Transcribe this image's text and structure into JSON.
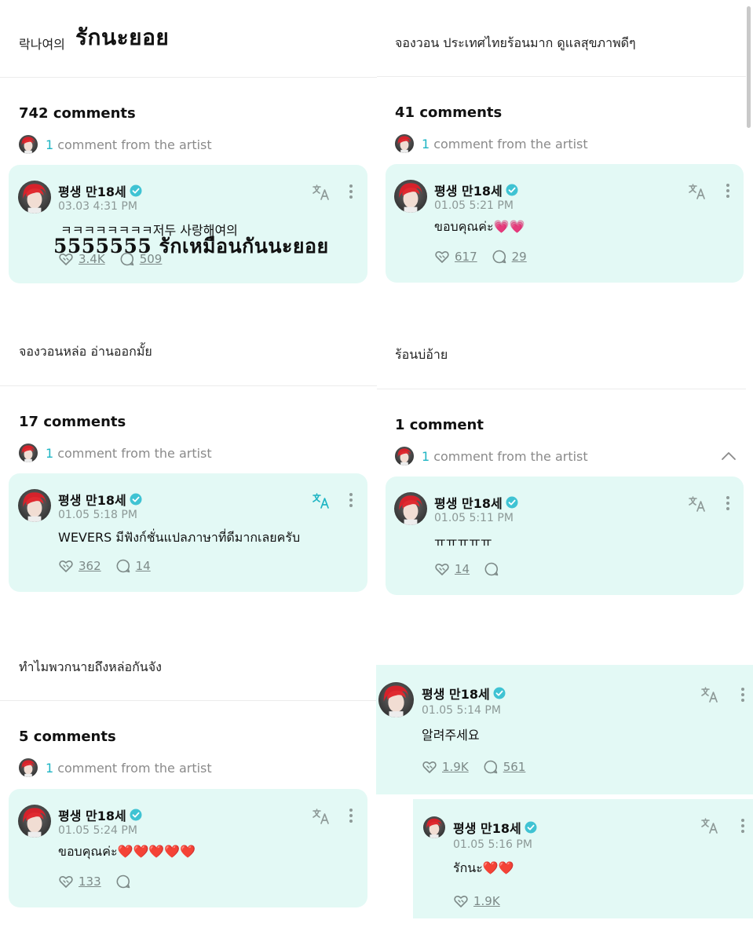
{
  "colors": {
    "card_bg": "#e3f9f5",
    "accent": "#1fb5c4",
    "muted": "#8a8a8a",
    "heart": "#e32626"
  },
  "left": {
    "post1": {
      "text": "락나여의",
      "handwritten": "รักนะยอย"
    },
    "thread1": {
      "count": "742 comments",
      "artist_num": "1",
      "artist_text": "comment from the artist",
      "comment": {
        "name": "평생 만18세",
        "time": "03.03 4:31 PM",
        "text": "ㅋㅋㅋㅋㅋㅋㅋㅋ저두 사랑해여의",
        "handwritten": "5555555 รักเหมือนกันนะยอย",
        "likes": "3.4K",
        "replies": "509"
      }
    },
    "post2": {
      "text": "จองวอนหล่อ อ่านออกมั้ย"
    },
    "thread2": {
      "count": "17 comments",
      "artist_num": "1",
      "artist_text": "comment from the artist",
      "comment": {
        "name": "평생 만18세",
        "time": "01.05 5:18 PM",
        "text": "WEVERS มีฟังก์ชั่นแปลภาษาที่ดีมากเลยครับ",
        "likes": "362",
        "replies": "14"
      }
    },
    "post3": {
      "text": "ทำไมพวกนายถึงหล่อกันจัง"
    },
    "thread3": {
      "count": "5 comments",
      "artist_num": "1",
      "artist_text": "comment from the artist",
      "comment": {
        "name": "평생 만18세",
        "time": "01.05 5:24 PM",
        "text": "ขอบคุณค่ะ",
        "hearts": "❤️❤️❤️❤️❤️",
        "likes": "133"
      }
    }
  },
  "right": {
    "post1": {
      "text": "จองวอน ประเทศไทยร้อนมาก ดูแลสุขภาพดีๆ"
    },
    "thread1": {
      "count": "41 comments",
      "artist_num": "1",
      "artist_text": "comment from the artist",
      "comment": {
        "name": "평생 만18세",
        "time": "01.05 5:21 PM",
        "text": "ขอบคุณค่ะ",
        "hearts": "💗💗",
        "likes": "617",
        "replies": "29"
      }
    },
    "post2": {
      "text": "ร้อนบ่อ้าย"
    },
    "thread2": {
      "count": "1 comment",
      "artist_num": "1",
      "artist_text": "comment from the artist",
      "comment": {
        "name": "평생 만18세",
        "time": "01.05 5:11 PM",
        "text": "ㅠㅠㅠㅠㅠ",
        "likes": "14"
      }
    },
    "thread3": {
      "comment": {
        "name": "평생 만18세",
        "time": "01.05 5:14 PM",
        "text": "알려주세요",
        "likes": "1.9K",
        "replies": "561"
      },
      "reply": {
        "name": "평생 만18세",
        "time": "01.05 5:16 PM",
        "text": "รักนะ",
        "hearts": "❤️❤️",
        "likes": "1.9K"
      }
    }
  },
  "icons": [
    "verified-badge-icon",
    "translate-icon",
    "more-vertical-icon",
    "like-icon",
    "reply-icon",
    "chevron-up-icon",
    "scrollbar"
  ]
}
